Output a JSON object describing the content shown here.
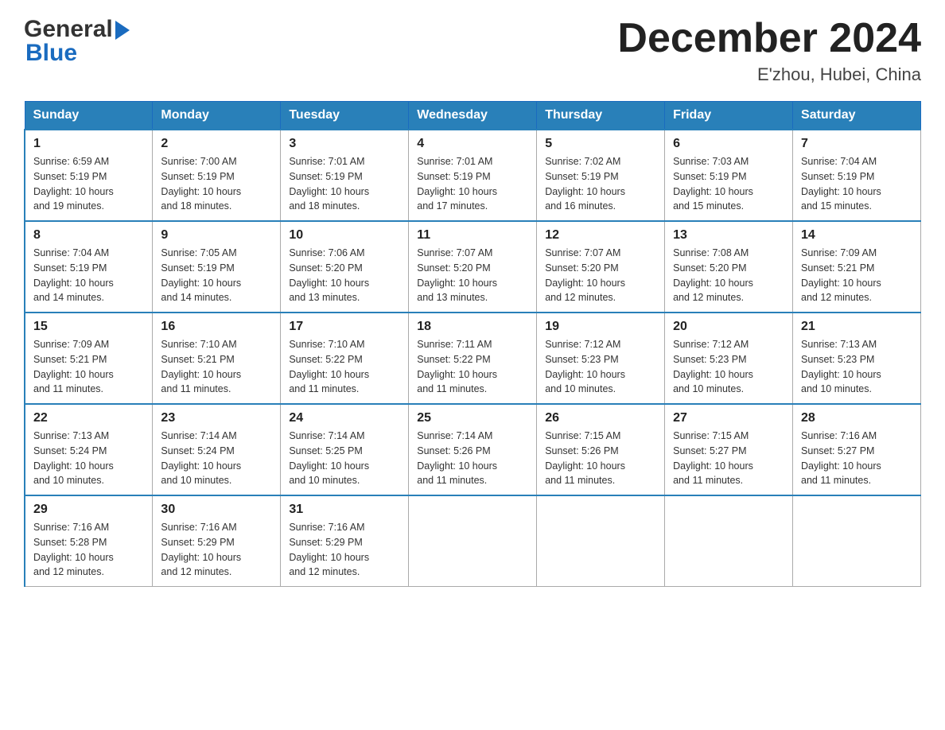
{
  "header": {
    "logo_general": "General",
    "logo_blue": "Blue",
    "month_title": "December 2024",
    "location": "E'zhou, Hubei, China"
  },
  "days_of_week": [
    "Sunday",
    "Monday",
    "Tuesday",
    "Wednesday",
    "Thursday",
    "Friday",
    "Saturday"
  ],
  "weeks": [
    [
      {
        "date": "1",
        "sunrise": "6:59 AM",
        "sunset": "5:19 PM",
        "daylight": "10 hours and 19 minutes."
      },
      {
        "date": "2",
        "sunrise": "7:00 AM",
        "sunset": "5:19 PM",
        "daylight": "10 hours and 18 minutes."
      },
      {
        "date": "3",
        "sunrise": "7:01 AM",
        "sunset": "5:19 PM",
        "daylight": "10 hours and 18 minutes."
      },
      {
        "date": "4",
        "sunrise": "7:01 AM",
        "sunset": "5:19 PM",
        "daylight": "10 hours and 17 minutes."
      },
      {
        "date": "5",
        "sunrise": "7:02 AM",
        "sunset": "5:19 PM",
        "daylight": "10 hours and 16 minutes."
      },
      {
        "date": "6",
        "sunrise": "7:03 AM",
        "sunset": "5:19 PM",
        "daylight": "10 hours and 15 minutes."
      },
      {
        "date": "7",
        "sunrise": "7:04 AM",
        "sunset": "5:19 PM",
        "daylight": "10 hours and 15 minutes."
      }
    ],
    [
      {
        "date": "8",
        "sunrise": "7:04 AM",
        "sunset": "5:19 PM",
        "daylight": "10 hours and 14 minutes."
      },
      {
        "date": "9",
        "sunrise": "7:05 AM",
        "sunset": "5:19 PM",
        "daylight": "10 hours and 14 minutes."
      },
      {
        "date": "10",
        "sunrise": "7:06 AM",
        "sunset": "5:20 PM",
        "daylight": "10 hours and 13 minutes."
      },
      {
        "date": "11",
        "sunrise": "7:07 AM",
        "sunset": "5:20 PM",
        "daylight": "10 hours and 13 minutes."
      },
      {
        "date": "12",
        "sunrise": "7:07 AM",
        "sunset": "5:20 PM",
        "daylight": "10 hours and 12 minutes."
      },
      {
        "date": "13",
        "sunrise": "7:08 AM",
        "sunset": "5:20 PM",
        "daylight": "10 hours and 12 minutes."
      },
      {
        "date": "14",
        "sunrise": "7:09 AM",
        "sunset": "5:21 PM",
        "daylight": "10 hours and 12 minutes."
      }
    ],
    [
      {
        "date": "15",
        "sunrise": "7:09 AM",
        "sunset": "5:21 PM",
        "daylight": "10 hours and 11 minutes."
      },
      {
        "date": "16",
        "sunrise": "7:10 AM",
        "sunset": "5:21 PM",
        "daylight": "10 hours and 11 minutes."
      },
      {
        "date": "17",
        "sunrise": "7:10 AM",
        "sunset": "5:22 PM",
        "daylight": "10 hours and 11 minutes."
      },
      {
        "date": "18",
        "sunrise": "7:11 AM",
        "sunset": "5:22 PM",
        "daylight": "10 hours and 11 minutes."
      },
      {
        "date": "19",
        "sunrise": "7:12 AM",
        "sunset": "5:23 PM",
        "daylight": "10 hours and 10 minutes."
      },
      {
        "date": "20",
        "sunrise": "7:12 AM",
        "sunset": "5:23 PM",
        "daylight": "10 hours and 10 minutes."
      },
      {
        "date": "21",
        "sunrise": "7:13 AM",
        "sunset": "5:23 PM",
        "daylight": "10 hours and 10 minutes."
      }
    ],
    [
      {
        "date": "22",
        "sunrise": "7:13 AM",
        "sunset": "5:24 PM",
        "daylight": "10 hours and 10 minutes."
      },
      {
        "date": "23",
        "sunrise": "7:14 AM",
        "sunset": "5:24 PM",
        "daylight": "10 hours and 10 minutes."
      },
      {
        "date": "24",
        "sunrise": "7:14 AM",
        "sunset": "5:25 PM",
        "daylight": "10 hours and 10 minutes."
      },
      {
        "date": "25",
        "sunrise": "7:14 AM",
        "sunset": "5:26 PM",
        "daylight": "10 hours and 11 minutes."
      },
      {
        "date": "26",
        "sunrise": "7:15 AM",
        "sunset": "5:26 PM",
        "daylight": "10 hours and 11 minutes."
      },
      {
        "date": "27",
        "sunrise": "7:15 AM",
        "sunset": "5:27 PM",
        "daylight": "10 hours and 11 minutes."
      },
      {
        "date": "28",
        "sunrise": "7:16 AM",
        "sunset": "5:27 PM",
        "daylight": "10 hours and 11 minutes."
      }
    ],
    [
      {
        "date": "29",
        "sunrise": "7:16 AM",
        "sunset": "5:28 PM",
        "daylight": "10 hours and 12 minutes."
      },
      {
        "date": "30",
        "sunrise": "7:16 AM",
        "sunset": "5:29 PM",
        "daylight": "10 hours and 12 minutes."
      },
      {
        "date": "31",
        "sunrise": "7:16 AM",
        "sunset": "5:29 PM",
        "daylight": "10 hours and 12 minutes."
      },
      null,
      null,
      null,
      null
    ]
  ],
  "labels": {
    "sunrise": "Sunrise:",
    "sunset": "Sunset:",
    "daylight": "Daylight:"
  }
}
